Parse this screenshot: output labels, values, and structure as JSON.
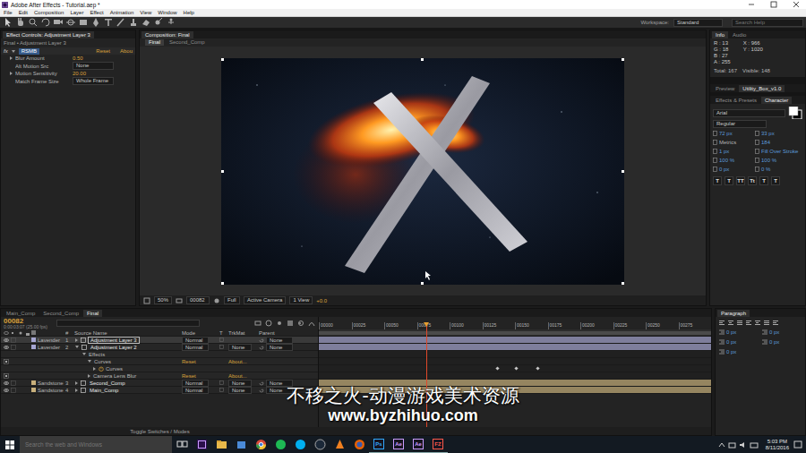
{
  "window": {
    "title": "Adobe After Effects - Tutorial.aep *"
  },
  "menu": [
    "File",
    "Edit",
    "Composition",
    "Layer",
    "Effect",
    "Animation",
    "View",
    "Window",
    "Help"
  ],
  "toolbar": {
    "workspace_label": "Workspace:",
    "workspace": "Standard",
    "search": {
      "placeholder": "Search Help"
    }
  },
  "effect_controls": {
    "tab": "Effect Controls: Adjustment Layer 3",
    "subtitle": "Final • Adjustment Layer 3",
    "effect": {
      "badge": "fx",
      "name": "RSMB",
      "reset": "Reset",
      "about": "Abou"
    },
    "params": [
      {
        "label": "Blur Amount",
        "value": "0.50",
        "kind": "number"
      },
      {
        "label": "Alt Motion Src",
        "value": "None",
        "kind": "dropdown"
      },
      {
        "label": "Motion Sensitivity",
        "value": "20.00",
        "kind": "number"
      },
      {
        "label": "Match Frame Size",
        "value": "Whole Frame",
        "kind": "dropdown"
      }
    ]
  },
  "composition": {
    "tab": "Composition: Final",
    "subtabs": [
      {
        "label": "Final",
        "selected": true
      },
      {
        "label": "Second_Comp",
        "selected": false
      }
    ],
    "footer": [
      {
        "text": "50%",
        "kind": "dropdown"
      },
      {
        "text": "00082",
        "kind": "field"
      },
      {
        "text": "Full",
        "kind": "dropdown"
      },
      {
        "text": "Active Camera",
        "kind": "dropdown"
      },
      {
        "text": "1 View",
        "kind": "dropdown"
      },
      {
        "text": "+0.0",
        "kind": "value"
      }
    ]
  },
  "info": {
    "tabs": [
      {
        "label": "Info",
        "selected": true
      },
      {
        "label": "Audio",
        "selected": false
      }
    ],
    "color_values": [
      "R : 13",
      "G : 18",
      "B : 27",
      "A : 255"
    ],
    "coords": [
      "X : 966",
      "Y : 1020"
    ],
    "total": "Total: 167",
    "visible": "Visible: 148"
  },
  "preview_tabs": [
    {
      "label": "Preview",
      "selected": false
    },
    {
      "label": "Utility_Box_v1.0",
      "selected": true
    }
  ],
  "text_tabs": [
    {
      "label": "Effects & Presets",
      "selected": false
    },
    {
      "label": "Character",
      "selected": true
    }
  ],
  "character": {
    "font": "Arial",
    "style": "Regular",
    "rows": [
      [
        "72 px",
        "33 px"
      ],
      [
        "Metrics",
        "184"
      ],
      [
        "1 px",
        "Fill Over Stroke"
      ],
      [
        "100 %",
        "100 %"
      ],
      [
        "0 px",
        "0 %"
      ]
    ],
    "styles": [
      "T",
      "T",
      "TT",
      "Tt",
      "T",
      "T"
    ]
  },
  "timeline": {
    "tabs": [
      {
        "label": "Main_Comp",
        "selected": false
      },
      {
        "label": "Second_Comp",
        "selected": false
      },
      {
        "label": "Final",
        "selected": true
      }
    ],
    "timecode": "00082",
    "timecode_sub": "0:00:03:07 (25.00 fps)",
    "columns": [
      "#",
      "Source Name",
      "Mode",
      "T",
      "TrkMat",
      "Parent"
    ],
    "ticks": [
      "00000",
      "00025",
      "00050",
      "00075",
      "00100",
      "00125",
      "00150",
      "00175",
      "00200",
      "00225",
      "00250",
      "00275"
    ],
    "playhead": {
      "level": 0.274
    },
    "rows": [
      {
        "kind": "layer",
        "num": "1",
        "label": "Lavender",
        "color": "#a6a6d2",
        "name": "Adjustment Layer 3",
        "mode": "Normal",
        "parent": "None",
        "selected": true,
        "expanded": false
      },
      {
        "kind": "layer",
        "num": "2",
        "label": "Lavender",
        "color": "#a6a6d2",
        "name": "Adjustment Layer 2",
        "mode": "Normal",
        "trkmat": "None",
        "parent": "None",
        "selected": false,
        "expanded": true
      },
      {
        "kind": "group",
        "name": "Effects",
        "selected": false,
        "expanded": true
      },
      {
        "kind": "effect",
        "name": "Curves",
        "reset": "Reset",
        "about": "About...",
        "selected": false,
        "expanded": true
      },
      {
        "kind": "property",
        "name": "Curves",
        "keyframes": [
          0.455,
          0.503,
          0.559
        ],
        "selected": false,
        "expanded": false
      },
      {
        "kind": "effect",
        "name": "Camera Lens Blur",
        "reset": "Reset",
        "about": "About...",
        "selected": false,
        "expanded": false
      },
      {
        "kind": "layer",
        "num": "3",
        "label": "Sandstone",
        "color": "#c8b07c",
        "name": "Second_Comp",
        "mode": "Normal",
        "trkmat": "None",
        "parent": "None",
        "selected": false,
        "expanded": false
      },
      {
        "kind": "layer",
        "num": "4",
        "label": "Sandstone",
        "color": "#c8b07c",
        "name": "Main_Comp",
        "mode": "Normal",
        "trkmat": "None",
        "parent": "None",
        "selected": false,
        "expanded": false
      }
    ],
    "toggle": "Toggle Switches / Modes"
  },
  "paragraph": {
    "tab": "Paragraph",
    "fields": [
      "0 px",
      "0 px",
      "0 px",
      "0 px",
      "0 px"
    ]
  },
  "taskbar": {
    "search": {
      "placeholder": "Search the web and Windows"
    },
    "apps": [
      {
        "label": "Ps",
        "color": "#31a8ff"
      },
      {
        "label": "Ae",
        "color": "#c99cff"
      },
      {
        "label": "Ae",
        "color": "#c99cff"
      },
      {
        "label": "FZ",
        "color": "#ff5a4a"
      }
    ],
    "time": "5:03 PM",
    "date": "8/11/2016"
  },
  "watermark": {
    "line1": "不移之火-动漫游戏美术资源",
    "line2": "www.byzhihuo.com"
  }
}
